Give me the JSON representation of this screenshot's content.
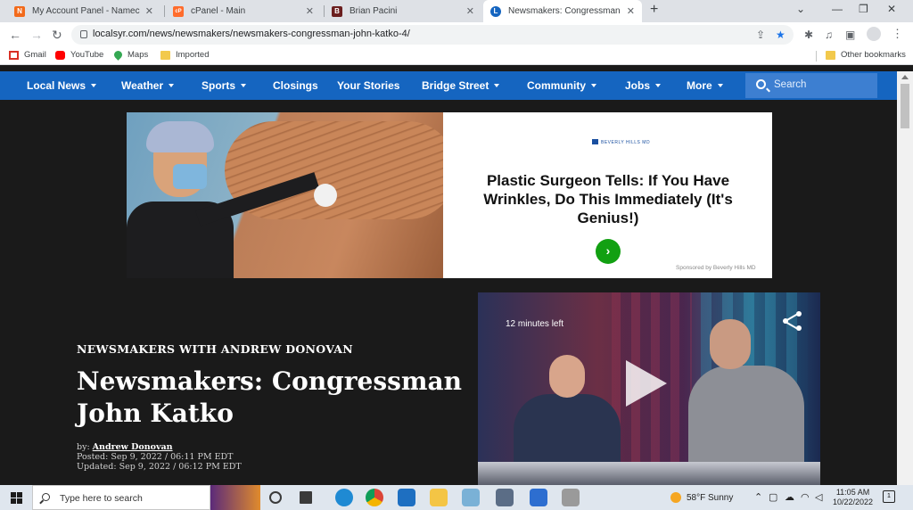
{
  "browser": {
    "tabs": [
      {
        "title": "My Account Panel - Namecheap.com",
        "favicon_color": "#f26a1b",
        "favicon_glyph": "N"
      },
      {
        "title": "cPanel - Main",
        "favicon_color": "#ff6c2c",
        "favicon_glyph": "cP"
      },
      {
        "title": "Brian Pacini",
        "favicon_color": "#6b1f1f",
        "favicon_glyph": "B"
      },
      {
        "title": "Newsmakers: Congressman John Katko",
        "favicon_color": "#1565c0",
        "favicon_glyph": "L",
        "active": true
      }
    ],
    "url": "localsyr.com/news/newsmakers/newsmakers-congressman-john-katko-4/",
    "bookmarks": [
      {
        "label": "Gmail",
        "icon": "gmail-icon",
        "color": "#d93025"
      },
      {
        "label": "YouTube",
        "icon": "youtube-icon",
        "color": "#ff0000"
      },
      {
        "label": "Maps",
        "icon": "maps-icon",
        "color": "#34a853"
      },
      {
        "label": "Imported",
        "icon": "folder-icon",
        "color": "#f2c94c"
      }
    ],
    "other_bookmarks": "Other bookmarks"
  },
  "site": {
    "accent": "#1565c0",
    "nav": [
      {
        "label": "Local News",
        "dropdown": true
      },
      {
        "label": "Weather",
        "dropdown": true
      },
      {
        "label": "Sports",
        "dropdown": true
      },
      {
        "label": "Closings",
        "dropdown": false
      },
      {
        "label": "Your Stories",
        "dropdown": false
      },
      {
        "label": "Bridge Street",
        "dropdown": true
      },
      {
        "label": "Community",
        "dropdown": true
      },
      {
        "label": "Jobs",
        "dropdown": true
      },
      {
        "label": "More",
        "dropdown": true
      }
    ],
    "search_placeholder": "Search"
  },
  "ad": {
    "headline": "Plastic Surgeon Tells: If You Have Wrinkles, Do This Immediately (It's Genius!)",
    "brand": "BEVERLY HILLS MD",
    "cta": "›",
    "sponsor": "Sponsored by Beverly Hills MD"
  },
  "article": {
    "kicker": "NEWSMAKERS WITH ANDREW DONOVAN",
    "title": "Newsmakers: Congressman John Katko",
    "by_prefix": "by: ",
    "author": "Andrew Donovan",
    "posted": "Posted: Sep 9, 2022 / 06:11 PM EDT",
    "updated": "Updated: Sep 9, 2022 / 06:12 PM EDT"
  },
  "video": {
    "time_left": "12 minutes left"
  },
  "taskbar": {
    "search_placeholder": "Type here to search",
    "weather": "58°F  Sunny",
    "time": "11:05 AM",
    "date": "10/22/2022",
    "notification_count": "1",
    "apps": [
      {
        "name": "task-view-icon",
        "color": "#3a3a3a"
      },
      {
        "name": "edge-icon",
        "color": "#1f8ad3"
      },
      {
        "name": "chrome-icon",
        "color": "#e8b622"
      },
      {
        "name": "mail-icon",
        "color": "#1e6fc1"
      },
      {
        "name": "file-explorer-icon",
        "color": "#f4c545"
      },
      {
        "name": "notepad-icon",
        "color": "#7ab1d6"
      },
      {
        "name": "calculator-icon",
        "color": "#5b6d86"
      },
      {
        "name": "zoom-icon",
        "color": "#2d6ed0"
      },
      {
        "name": "store-icon",
        "color": "#9a9a9a"
      }
    ]
  }
}
